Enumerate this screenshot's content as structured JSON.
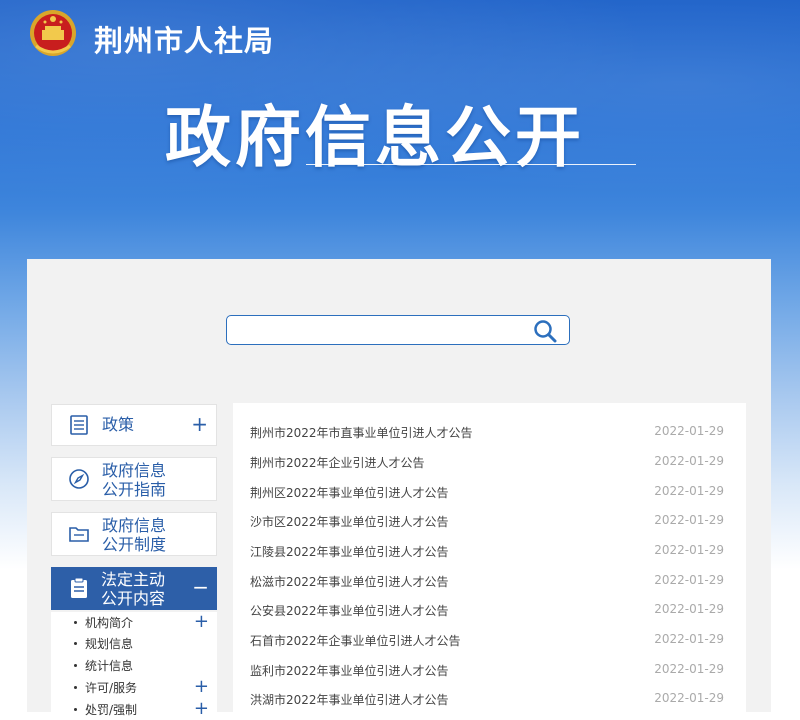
{
  "header": {
    "site_name": "荆州市人社局",
    "title": "政府信息公开"
  },
  "search": {
    "placeholder": ""
  },
  "sidebar": {
    "items": [
      {
        "label": "政策",
        "icon": "document-list-icon"
      },
      {
        "label_line1": "政府信息",
        "label_line2": "公开指南",
        "icon": "compass-icon"
      },
      {
        "label_line1": "政府信息",
        "label_line2": "公开制度",
        "icon": "folder-icon"
      },
      {
        "label_line1": "法定主动",
        "label_line2": "公开内容",
        "icon": "clipboard-icon"
      }
    ],
    "sub_items": [
      {
        "label": "机构简介"
      },
      {
        "label": "规划信息"
      },
      {
        "label": "统计信息"
      },
      {
        "label": "许可/服务"
      },
      {
        "label": "处罚/强制"
      }
    ]
  },
  "articles": [
    {
      "title": "荆州市2022年市直事业单位引进人才公告",
      "date": "2022-01-29"
    },
    {
      "title": "荆州市2022年企业引进人才公告",
      "date": "2022-01-29"
    },
    {
      "title": "荆州区2022年事业单位引进人才公告",
      "date": "2022-01-29"
    },
    {
      "title": "沙市区2022年事业单位引进人才公告",
      "date": "2022-01-29"
    },
    {
      "title": "江陵县2022年事业单位引进人才公告",
      "date": "2022-01-29"
    },
    {
      "title": "松滋市2022年事业单位引进人才公告",
      "date": "2022-01-29"
    },
    {
      "title": "公安县2022年事业单位引进人才公告",
      "date": "2022-01-29"
    },
    {
      "title": "石首市2022年企事业单位引进人才公告",
      "date": "2022-01-29"
    },
    {
      "title": "监利市2022年事业单位引进人才公告",
      "date": "2022-01-29"
    },
    {
      "title": "洪湖市2022年事业单位引进人才公告",
      "date": "2022-01-29"
    }
  ],
  "colors": {
    "brand_blue": "#2d5fa8",
    "banner_blue": "#1e62c9"
  }
}
